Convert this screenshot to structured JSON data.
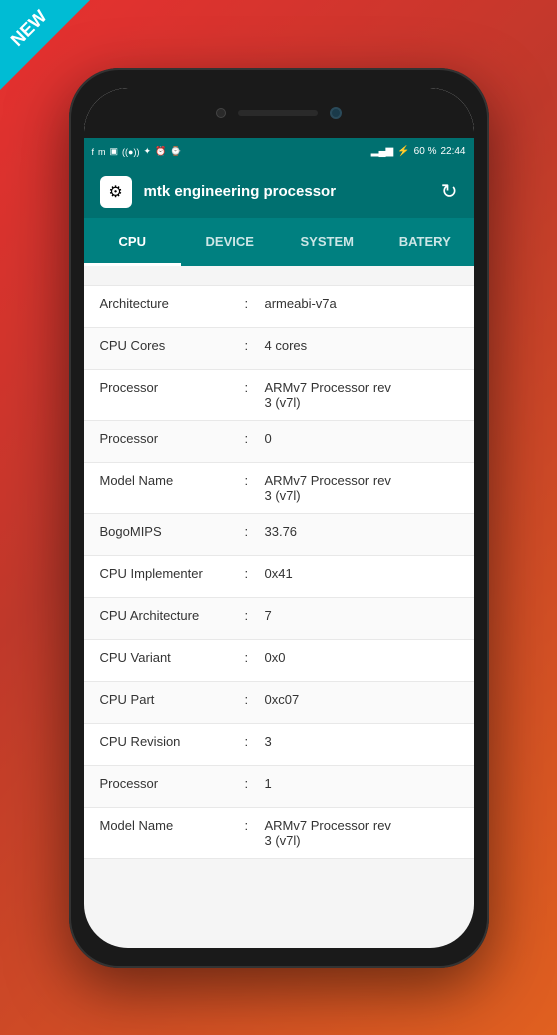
{
  "badge": {
    "text": "NEW"
  },
  "status_bar": {
    "time": "22:44",
    "battery": "60 %",
    "signal": "▂▄▆",
    "wifi": "WiFi"
  },
  "header": {
    "title": "mtk engineering processor",
    "icon": "⚙"
  },
  "tabs": [
    {
      "label": "CPU",
      "active": true
    },
    {
      "label": "DEVICE",
      "active": false
    },
    {
      "label": "SYSTEM",
      "active": false
    },
    {
      "label": "BATERY",
      "active": false
    }
  ],
  "rows": [
    {
      "label": "Architecture",
      "separator": ":",
      "value": "armeabi-v7a"
    },
    {
      "label": "CPU Cores",
      "separator": ":",
      "value": "4 cores"
    },
    {
      "label": "Processor",
      "separator": ":",
      "value": "ARMv7 Processor rev\n3 (v7l)"
    },
    {
      "label": "Processor",
      "separator": ":",
      "value": "0"
    },
    {
      "label": "Model Name",
      "separator": ":",
      "value": "ARMv7 Processor rev\n3 (v7l)"
    },
    {
      "label": "BogoMIPS",
      "separator": ":",
      "value": "33.76"
    },
    {
      "label": "CPU Implementer",
      "separator": ":",
      "value": "0x41"
    },
    {
      "label": "CPU Architecture",
      "separator": ":",
      "value": "7"
    },
    {
      "label": "CPU Variant",
      "separator": ":",
      "value": "0x0"
    },
    {
      "label": "CPU Part",
      "separator": ":",
      "value": "0xc07"
    },
    {
      "label": "CPU Revision",
      "separator": ":",
      "value": "3"
    },
    {
      "label": "Processor",
      "separator": ":",
      "value": "1"
    },
    {
      "label": "Model Name",
      "separator": ":",
      "value": "ARMv7 Processor rev\n3 (v7l)"
    }
  ]
}
